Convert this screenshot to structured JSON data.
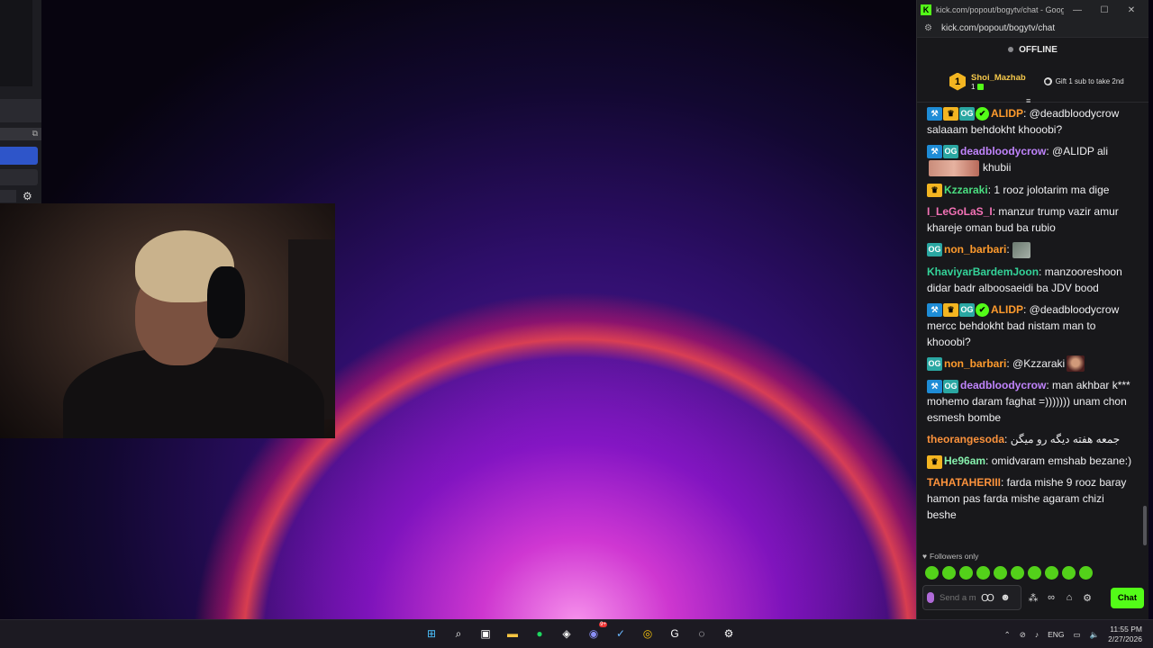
{
  "browser": {
    "title": "kick.com/popout/bogytv/chat - Google...",
    "url": "kick.com/popout/bogytv/chat",
    "logo_letter": "K"
  },
  "stream": {
    "status": "OFFLINE"
  },
  "leaderboard": {
    "rank": "1",
    "username": "Shoi_Mazhab",
    "sub_count": "1",
    "gift_text": "Gift 1 sub to take 2nd"
  },
  "messages": [
    {
      "badges": [
        "mod",
        "crown",
        "og",
        "ver"
      ],
      "user": "ALIDP",
      "color": "#ff9b2d",
      "text": "@deadbloodycrow salaaam behdokht khooobi?"
    },
    {
      "badges": [
        "mod",
        "og"
      ],
      "user": "deadbloodycrow",
      "color": "#c084fc",
      "text": "@ALIDP ali",
      "emote": "large",
      "text2": "khubii"
    },
    {
      "badges": [
        "crown"
      ],
      "user": "Kzzaraki",
      "color": "#4ade80",
      "text": "1 rooz jolotarim ma dige"
    },
    {
      "badges": [],
      "user": "I_LeGoLaS_I",
      "color": "#f472b6",
      "text": "manzur trump vazir amur khareje oman bud ba rubio"
    },
    {
      "badges": [
        "og"
      ],
      "user": "non_barbari",
      "color": "#ff9b2d",
      "text": "",
      "emote": "small"
    },
    {
      "badges": [],
      "user": "KhaviyarBardemJoon",
      "color": "#34d399",
      "text": "manzooreshoon didar badr alboosaeidi ba JDV bood"
    },
    {
      "badges": [
        "mod",
        "crown",
        "og",
        "ver"
      ],
      "user": "ALIDP",
      "color": "#ff9b2d",
      "text": "@deadbloodycrow mercc behdokht bad nistam man to khooobi?"
    },
    {
      "badges": [
        "og"
      ],
      "user": "non_barbari",
      "color": "#ff9b2d",
      "text": "@Kzzaraki",
      "emote": "face"
    },
    {
      "badges": [
        "mod",
        "og"
      ],
      "user": "deadbloodycrow",
      "color": "#c084fc",
      "text": "man akhbar k*** mohemo daram faghat =))))))) unam chon esmesh bombe"
    },
    {
      "badges": [],
      "user": "theorangesoda",
      "color": "#fb923c",
      "text": "جمعه هفته دیگه رو میگن"
    },
    {
      "badges": [
        "crown"
      ],
      "user": "He96am",
      "color": "#86efac",
      "text": "omidvaram emshab bezane:)"
    },
    {
      "badges": [],
      "user": "TAHATAHERIII",
      "color": "#fb923c",
      "text": "farda mishe 9 rooz baray hamon pas farda mishe agaram chizi beshe"
    }
  ],
  "chat_footer": {
    "mode": "Followers only",
    "placeholder": "Send a message",
    "chat_button": "Chat"
  },
  "taskbar": {
    "language": "ENG",
    "time": "11:55 PM",
    "date": "2/27/2026",
    "discord_badge": "9+"
  }
}
